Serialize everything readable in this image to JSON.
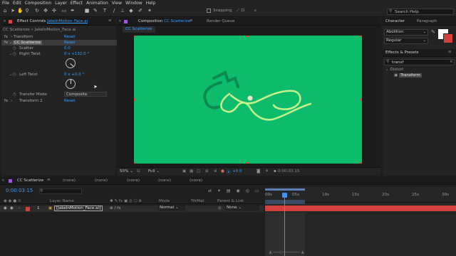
{
  "menu": [
    "File",
    "Edit",
    "Composition",
    "Layer",
    "Effect",
    "Animation",
    "View",
    "Window",
    "Help"
  ],
  "toolbar": {
    "snapping_label": "Snapping",
    "search_placeholder": "Search Help"
  },
  "effect_controls": {
    "tab_label": "Effect Controls",
    "tab_file": "JakeInMotion_Face.ai",
    "breadcrumb": "CC Scatterize • JakeInMotion_Face.ai",
    "rows": [
      {
        "label": "Transform",
        "value": "Reset"
      },
      {
        "label": "CC Scatterize",
        "value": "Reset"
      },
      {
        "label": "Scatter",
        "value": "0.0"
      },
      {
        "label": "Right Twist",
        "value": "0 x +132.0 °"
      },
      {
        "label": "Left Twist",
        "value": "0 x +0.0 °"
      },
      {
        "label": "Transfer Mode",
        "value": "Composite"
      },
      {
        "label": "Transform 2",
        "value": "Reset"
      }
    ]
  },
  "composition": {
    "tab_label": "Composition",
    "tab_name": "CC Scatterize",
    "sub_tab": "CC Scatterize",
    "render_queue": "Render Queue",
    "canvas_color": "#0cbc6c",
    "zoom": "50%",
    "resolution": "Full",
    "exposure": "+0.0",
    "timecode": "0:00:03:15"
  },
  "right_panel": {
    "tab_character": "Character",
    "tab_paragraph": "Paragraph",
    "font": "Abolition",
    "style": "Regular",
    "effects_title": "Effects & Presets",
    "search_value": "transf",
    "category": "Distort",
    "item": "Transform"
  },
  "timeline": {
    "comp_name": "CC Scatterize",
    "none_tabs": [
      "(none)",
      "(none)",
      "(none)",
      "(none)",
      "(none)"
    ],
    "timecode": "0:00:03:15",
    "headers": {
      "layer_name": "Layer Name",
      "mode": "Mode",
      "trkmat": "TrkMat",
      "parent": "Parent & Link"
    },
    "layer": {
      "number": "1",
      "name": "[JakeInMotion_Face.ai]",
      "mode": "Normal",
      "parent": "None"
    },
    "ruler": [
      "00s",
      "05s",
      "10s",
      "15s",
      "20s",
      "25s",
      "30s"
    ],
    "playhead_progress": 0.1
  }
}
